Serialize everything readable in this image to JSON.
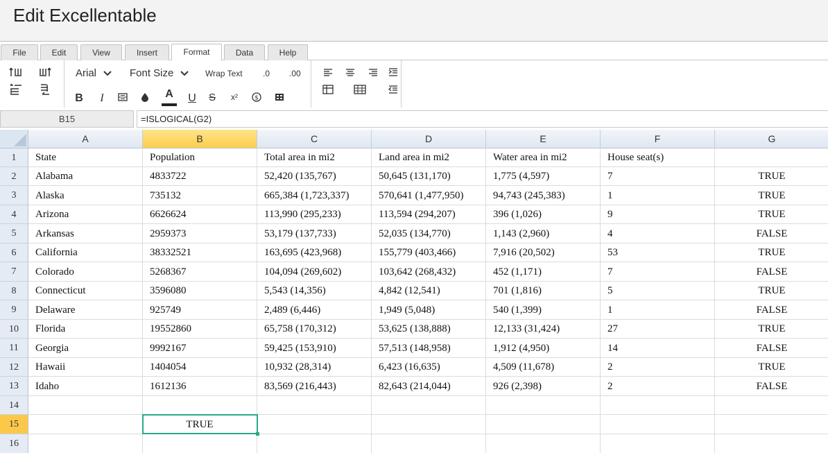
{
  "window": {
    "title": "Edit Excellentable"
  },
  "menu": {
    "tabs": [
      "File",
      "Edit",
      "View",
      "Insert",
      "Format",
      "Data",
      "Help"
    ],
    "active": "Format"
  },
  "toolbar": {
    "font_family": "Arial",
    "font_size": "Font Size",
    "wrap_text": "Wrap Text",
    "decimal_decrease": ".0",
    "decimal_increase": ".00",
    "bold": "B",
    "italic": "I",
    "font_color": "A",
    "underline": "U",
    "strikethrough": "S",
    "superscript": "x²"
  },
  "formula_bar": {
    "cell_ref": "B15",
    "formula": "=ISLOGICAL(G2)"
  },
  "sheet": {
    "columns": [
      "A",
      "B",
      "C",
      "D",
      "E",
      "F",
      "G"
    ],
    "selected_column": "B",
    "selected_row": "15",
    "rows": [
      {
        "num": "1",
        "cells": [
          "State",
          "Population",
          "Total area in mi2",
          "Land area in mi2",
          "Water area in mi2",
          "House seat(s)",
          ""
        ]
      },
      {
        "num": "2",
        "cells": [
          "Alabama",
          "4833722",
          "52,420 (135,767)",
          "50,645 (131,170)",
          "1,775 (4,597)",
          "7",
          "TRUE"
        ]
      },
      {
        "num": "3",
        "cells": [
          "Alaska",
          "735132",
          "665,384 (1,723,337)",
          "570,641 (1,477,950)",
          "94,743 (245,383)",
          "1",
          "TRUE"
        ]
      },
      {
        "num": "4",
        "cells": [
          "Arizona",
          "6626624",
          "113,990 (295,233)",
          "113,594 (294,207)",
          "396 (1,026)",
          "9",
          "TRUE"
        ]
      },
      {
        "num": "5",
        "cells": [
          "Arkansas",
          "2959373",
          "53,179 (137,733)",
          "52,035 (134,770)",
          "1,143 (2,960)",
          "4",
          "FALSE"
        ]
      },
      {
        "num": "6",
        "cells": [
          "California",
          "38332521",
          "163,695 (423,968)",
          "155,779 (403,466)",
          "7,916 (20,502)",
          "53",
          "TRUE"
        ]
      },
      {
        "num": "7",
        "cells": [
          "Colorado",
          "5268367",
          "104,094 (269,602)",
          "103,642 (268,432)",
          "452 (1,171)",
          "7",
          "FALSE"
        ]
      },
      {
        "num": "8",
        "cells": [
          "Connecticut",
          "3596080",
          "5,543 (14,356)",
          "4,842 (12,541)",
          "701 (1,816)",
          "5",
          "TRUE"
        ]
      },
      {
        "num": "9",
        "cells": [
          "Delaware",
          "925749",
          "2,489 (6,446)",
          "1,949 (5,048)",
          "540 (1,399)",
          "1",
          "FALSE"
        ]
      },
      {
        "num": "10",
        "cells": [
          "Florida",
          "19552860",
          "65,758 (170,312)",
          "53,625 (138,888)",
          "12,133 (31,424)",
          "27",
          "TRUE"
        ]
      },
      {
        "num": "11",
        "cells": [
          "Georgia",
          "9992167",
          "59,425 (153,910)",
          "57,513 (148,958)",
          "1,912 (4,950)",
          "14",
          "FALSE"
        ]
      },
      {
        "num": "12",
        "cells": [
          "Hawaii",
          "1404054",
          "10,932 (28,314)",
          "6,423 (16,635)",
          "4,509 (11,678)",
          "2",
          "TRUE"
        ]
      },
      {
        "num": "13",
        "cells": [
          "Idaho",
          "1612136",
          "83,569 (216,443)",
          "82,643 (214,044)",
          "926 (2,398)",
          "2",
          "FALSE"
        ]
      },
      {
        "num": "14",
        "cells": [
          "",
          "",
          "",
          "",
          "",
          "",
          ""
        ]
      },
      {
        "num": "15",
        "cells": [
          "",
          "TRUE",
          "",
          "",
          "",
          "",
          ""
        ]
      },
      {
        "num": "16",
        "cells": [
          "",
          "",
          "",
          "",
          "",
          "",
          ""
        ]
      }
    ]
  },
  "colors": {
    "selection": "#2ba88a",
    "selected_header": "#fcc84a",
    "header_bg": "#dfe7f1"
  }
}
